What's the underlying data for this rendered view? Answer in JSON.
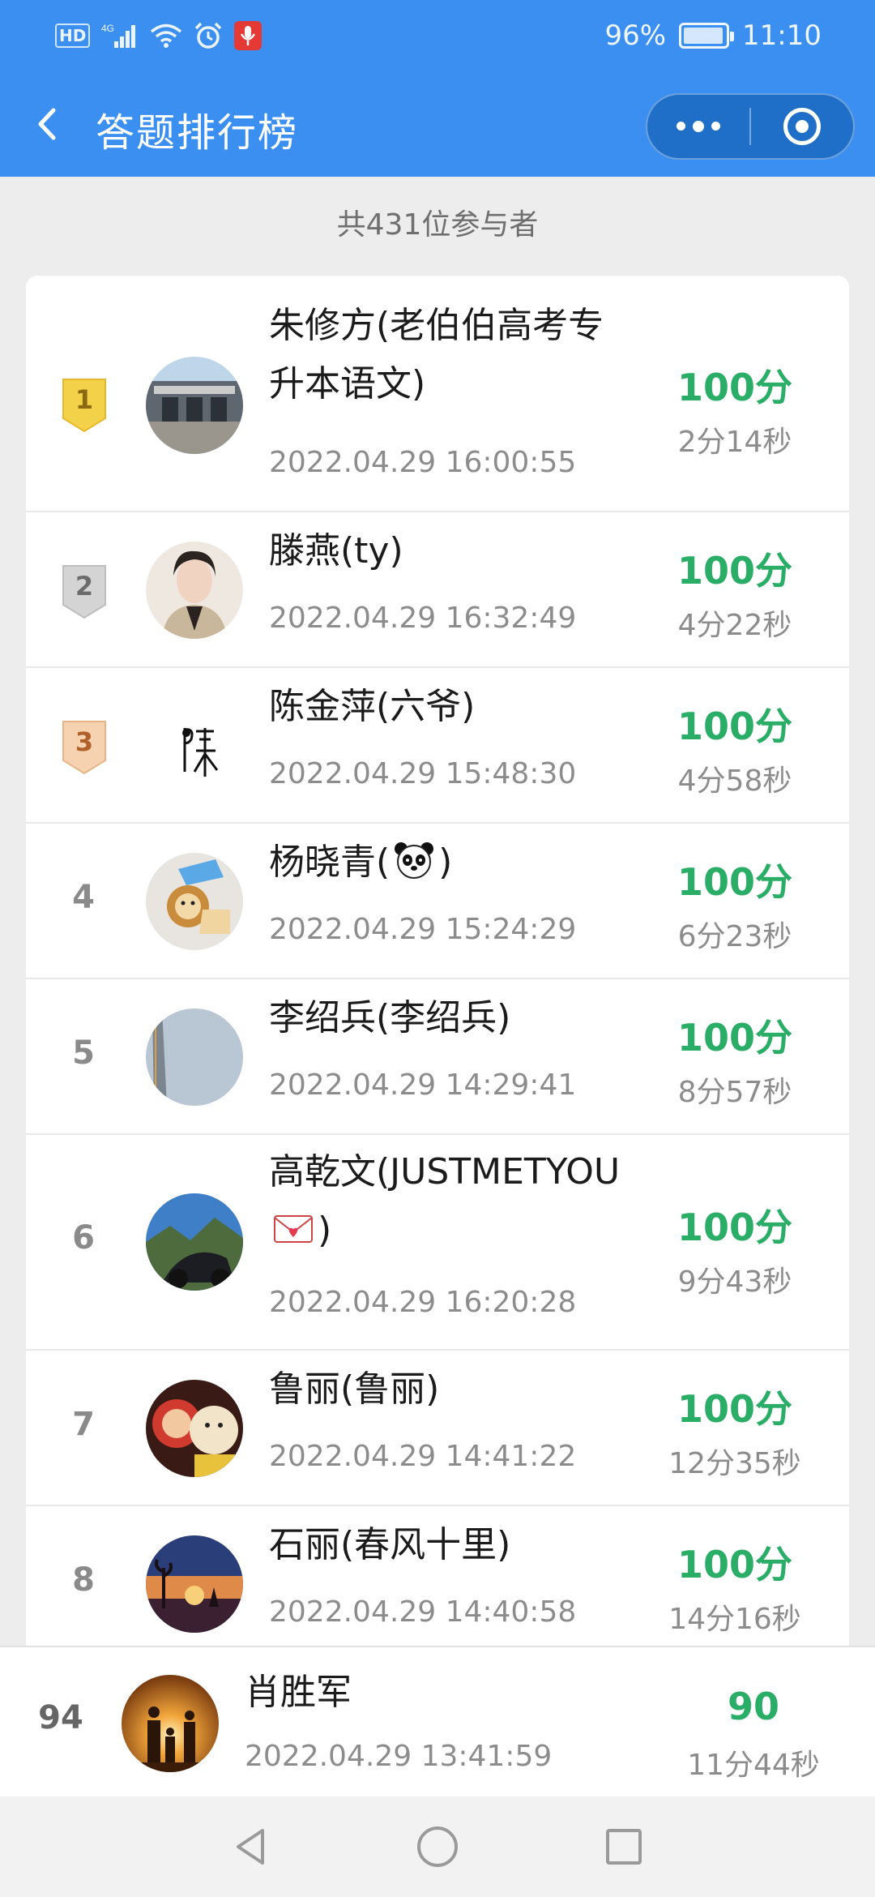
{
  "status_bar": {
    "left_icons": [
      "hd-icon",
      "signal-4g-icon",
      "wifi-icon",
      "alarm-icon",
      "mic-icon"
    ],
    "hd_label": "HD",
    "signal_label": "4G",
    "battery_percent": "96%",
    "battery_level": 0.96,
    "time": "11:10"
  },
  "navbar": {
    "title": "答题排行榜",
    "back_icon": "chevron-left-icon",
    "menu_icon": "more-dots-icon",
    "close_icon": "target-close-icon",
    "background": "#3b8ff0"
  },
  "summary": {
    "participants_text": "共431位参与者"
  },
  "colors": {
    "score_green": "#2aae67",
    "medal_gold": "#f3d24a",
    "medal_silver": "#d4d4d4",
    "medal_bronze": "#f6d2b0"
  },
  "leaderboard": [
    {
      "rank": "1",
      "name": "朱修方(老伯伯高考专升本语文)",
      "timestamp": "2022.04.29 16:00:55",
      "score": "100分",
      "duration": "2分14秒",
      "avatar": "building-photo"
    },
    {
      "rank": "2",
      "name": "滕燕(ty)",
      "timestamp": "2022.04.29 16:32:49",
      "score": "100分",
      "duration": "4分22秒",
      "avatar": "woman-portrait"
    },
    {
      "rank": "3",
      "name": "陈金萍(六爷)",
      "timestamp": "2022.04.29 15:48:30",
      "score": "100分",
      "duration": "4分58秒",
      "avatar": "calligraphy-chen"
    },
    {
      "rank": "4",
      "name_prefix": "杨晓青(",
      "name_suffix": ")",
      "name_emoji": "panda-emoji",
      "timestamp": "2022.04.29 15:24:29",
      "score": "100分",
      "duration": "6分23秒",
      "avatar": "lion-toy"
    },
    {
      "rank": "5",
      "name": "李绍兵(李绍兵)",
      "timestamp": "2022.04.29 14:29:41",
      "score": "100分",
      "duration": "8分57秒",
      "avatar": "bridge-sky"
    },
    {
      "rank": "6",
      "name_prefix": "高乾文(JUSTMETYOU",
      "name_suffix": ")",
      "name_emoji": "love-letter-emoji",
      "timestamp": "2022.04.29 16:20:28",
      "score": "100分",
      "duration": "9分43秒",
      "avatar": "motorcycle-mountain"
    },
    {
      "rank": "7",
      "name": "鲁丽(鲁丽)",
      "timestamp": "2022.04.29 14:41:22",
      "score": "100分",
      "duration": "12分35秒",
      "avatar": "plush-toys"
    },
    {
      "rank": "8",
      "name": "石丽(春风十里)",
      "timestamp": "2022.04.29 14:40:58",
      "score": "100分",
      "duration": "14分16秒",
      "avatar": "sunset-illustration"
    }
  ],
  "my_entry": {
    "rank": "94",
    "name": "肖胜军",
    "timestamp": "2022.04.29 13:41:59",
    "score": "90",
    "duration": "11分44秒",
    "avatar": "family-sunset"
  },
  "system_nav": {
    "icons": [
      "back-triangle-icon",
      "home-circle-icon",
      "recents-square-icon"
    ]
  }
}
